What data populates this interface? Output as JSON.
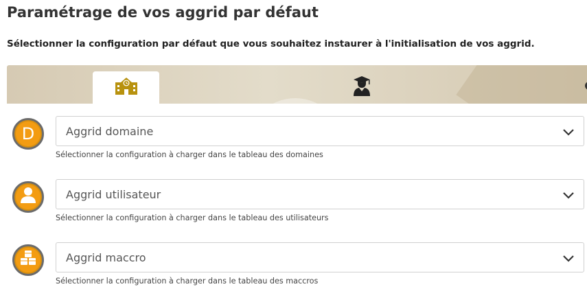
{
  "header": {
    "title": "Paramétrage de vos aggrid par défaut",
    "subtitle": "Sélectionner la configuration par défaut que vous souhaitez instaurer à l'initialisation de vos aggrid."
  },
  "tabs": [
    {
      "icon": "school-building-icon",
      "active": true
    },
    {
      "icon": "graduate-user-icon",
      "active": false
    }
  ],
  "rows": [
    {
      "badge_letter": "D",
      "badge_icon": "letter-d-icon",
      "select_value": "Aggrid domaine",
      "helper": "Sélectionner la configuration à charger dans le tableau des domaines"
    },
    {
      "badge_icon": "user-icon",
      "select_value": "Aggrid utilisateur",
      "helper": "Sélectionner la configuration à charger dans le tableau des utilisateurs"
    },
    {
      "badge_icon": "cubes-icon",
      "select_value": "Aggrid maccro",
      "helper": "Sélectionner la configuration à charger dans le tableau des maccros"
    }
  ],
  "colors": {
    "accent_gold": "#b8920f",
    "badge_orange": "#f39c12",
    "banner": "#d9cfb9"
  }
}
